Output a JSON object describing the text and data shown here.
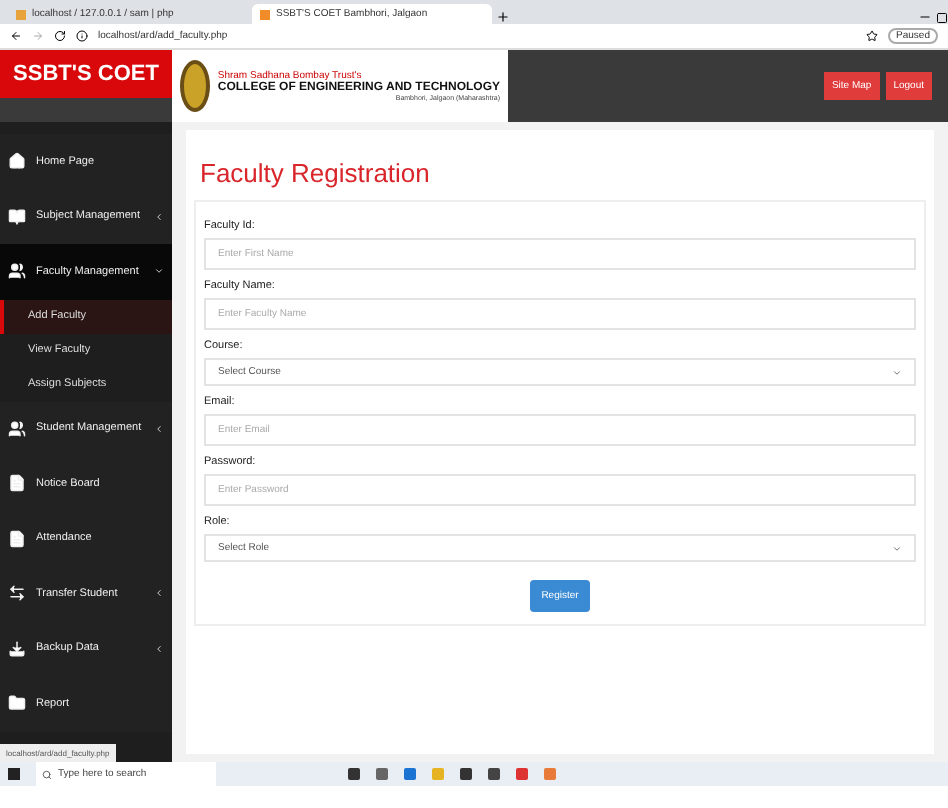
{
  "browser": {
    "tabs": [
      {
        "title": "localhost / 127.0.0.1 / sam | php",
        "selected": false
      },
      {
        "title": "SSBT'S COET Bambhori, Jalgaon",
        "selected": true
      }
    ],
    "address": "localhost/ard/add_faculty.php",
    "profile": "Paused"
  },
  "header": {
    "brand": "SSBT'S COET",
    "trust": "Shram Sadhana Bombay Trust's",
    "college": "COLLEGE OF ENGINEERING AND TECHNOLOGY",
    "place": "Bambhori, Jalgaon (Maharashtra)",
    "buttons": [
      "Site Map",
      "Logout"
    ]
  },
  "sidebar": {
    "items": [
      {
        "label": "Home Page",
        "submenu": false,
        "expanded": false
      },
      {
        "label": "Subject Management",
        "submenu": true,
        "expanded": false
      },
      {
        "label": "Faculty Management",
        "submenu": true,
        "expanded": true,
        "children": [
          {
            "label": "Add Faculty",
            "selected": true
          },
          {
            "label": "View Faculty",
            "selected": false
          },
          {
            "label": "Assign Subjects",
            "selected": false
          }
        ]
      },
      {
        "label": "Student Management",
        "submenu": true,
        "expanded": false
      },
      {
        "label": "Notice Board",
        "submenu": false,
        "expanded": false
      },
      {
        "label": "Attendance",
        "submenu": false,
        "expanded": false
      },
      {
        "label": "Transfer Student",
        "submenu": true,
        "expanded": false
      },
      {
        "label": "Backup Data",
        "submenu": true,
        "expanded": false
      },
      {
        "label": "Report",
        "submenu": false,
        "expanded": false
      }
    ]
  },
  "status_url": "localhost/ard/add_faculty.php",
  "form": {
    "title": "Faculty Registration",
    "fields": [
      {
        "label": "Faculty Id:",
        "kind": "text",
        "placeholder": "Enter First Name"
      },
      {
        "label": "Faculty Name:",
        "kind": "text",
        "placeholder": "Enter Faculty Name"
      },
      {
        "label": "Course:",
        "kind": "select",
        "placeholder": "Select Course"
      },
      {
        "label": "Email:",
        "kind": "text",
        "placeholder": "Enter Email"
      },
      {
        "label": "Password:",
        "kind": "text",
        "placeholder": "Enter Password"
      },
      {
        "label": "Role:",
        "kind": "select",
        "placeholder": "Select Role"
      }
    ],
    "submit": "Register"
  },
  "taskbar": {
    "search_placeholder": "Type here to search"
  }
}
